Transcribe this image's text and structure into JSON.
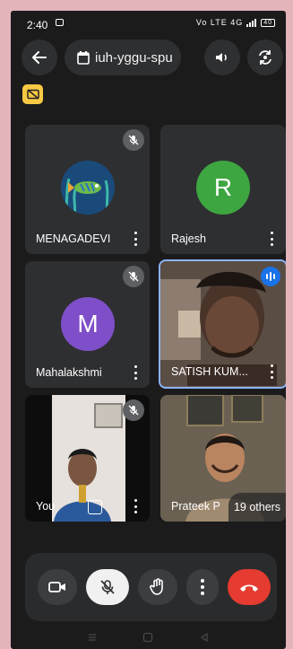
{
  "status": {
    "time": "2:40",
    "signal": "Vo LTE 4G",
    "battery": "40"
  },
  "meeting": {
    "code": "iuh-yggu-spu"
  },
  "participants": [
    {
      "name": "MENAGADEVI",
      "muted": true
    },
    {
      "name": "Rajesh",
      "initial": "R",
      "avatar_color": "#3ea641"
    },
    {
      "name": "Mahalakshmi",
      "initial": "M",
      "avatar_color": "#7f4fc9",
      "muted": true
    },
    {
      "name": "SATISH KUM...",
      "speaking": true
    },
    {
      "name": "You",
      "muted": true
    },
    {
      "name": "Prateek P"
    }
  ],
  "others_label": "19 others",
  "colors": {
    "end_call": "#e53b30",
    "warning": "#f7c844",
    "speaking_border": "#8ab4f8"
  }
}
